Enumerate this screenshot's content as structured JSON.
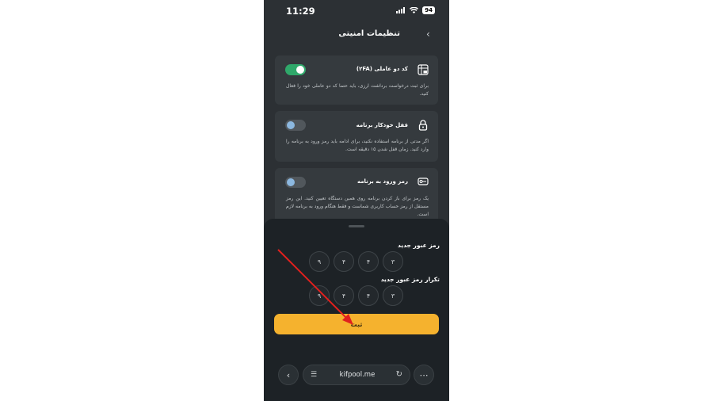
{
  "status_bar": {
    "time": "11:29",
    "battery": "94"
  },
  "header": {
    "title": "تنظیمات امنیتی",
    "back_icon": "chevron-left-icon"
  },
  "cards": [
    {
      "title": "کد دو عاملی (۲FA)",
      "icon": "grid-lock-icon",
      "toggle": "on",
      "description": "برای ثبت درخواست برداشت ارزی، باید حتما کد دو عاملی خود را فعال کنید."
    },
    {
      "title": "قفل خودکار برنامه",
      "icon": "lock-icon",
      "toggle": "off",
      "description": "اگر مدتی از برنامه استفاده نکنید، برای ادامه باید رمز ورود به برنامه را وارد کنید. زمان قفل شدن ۱۵ دقیقه است."
    },
    {
      "title": "رمز ورود به برنامه",
      "icon": "key-icon",
      "toggle": "off",
      "description": "یک رمز برای باز کردن برنامه روی همین دستگاه تعیین کنید. این رمز مستقل از رمز حساب کاربری شماست و فقط هنگام ورود به برنامه لازم است."
    }
  ],
  "sheet": {
    "new_password_label": "رمز عبور جدید",
    "new_password_digits": [
      "۹",
      "۴",
      "۴",
      "۳"
    ],
    "repeat_password_label": "تکرار رمز عبور جدید",
    "repeat_password_digits": [
      "۹",
      "۴",
      "۴",
      "۳"
    ],
    "submit_label": "ثبت"
  },
  "browser": {
    "url": "kifpool.me"
  },
  "colors": {
    "accent": "#f5b22e",
    "toggle_on": "#2fa86a",
    "arrow": "#e0201e"
  }
}
